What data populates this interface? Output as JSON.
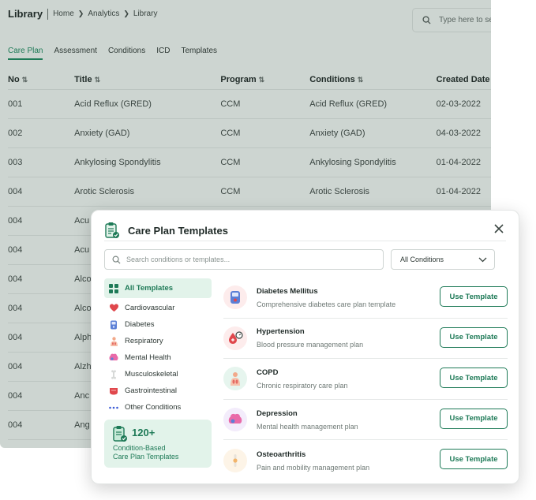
{
  "background": {
    "title": "Library",
    "breadcrumb": [
      "Home",
      "Analytics",
      "Library"
    ],
    "search_placeholder": "Type here to se",
    "tabs": [
      "Care Plan",
      "Assessment",
      "Conditions",
      "ICD",
      "Templates"
    ],
    "active_tab": "Care Plan",
    "columns": [
      "No",
      "Title",
      "Program",
      "Conditions",
      "Created Date"
    ],
    "rows": [
      {
        "no": "001",
        "title": "Acid Reflux (GRED)",
        "program": "CCM",
        "conditions": "Acid Reflux (GRED)",
        "date": "02-03-2022"
      },
      {
        "no": "002",
        "title": "Anxiety (GAD)",
        "program": "CCM",
        "conditions": "Anxiety (GAD)",
        "date": "04-03-2022"
      },
      {
        "no": "003",
        "title": "Ankylosing Spondylitis",
        "program": "CCM",
        "conditions": "Ankylosing Spondylitis",
        "date": "01-04-2022"
      },
      {
        "no": "004",
        "title": "Arotic Sclerosis",
        "program": "CCM",
        "conditions": "Arotic Sclerosis",
        "date": "01-04-2022"
      },
      {
        "no": "004",
        "title": "Acu",
        "program": "",
        "conditions": "",
        "date": ""
      },
      {
        "no": "004",
        "title": "Acu",
        "program": "",
        "conditions": "",
        "date": ""
      },
      {
        "no": "004",
        "title": "Alco",
        "program": "",
        "conditions": "",
        "date": ""
      },
      {
        "no": "004",
        "title": "Alco",
        "program": "",
        "conditions": "",
        "date": ""
      },
      {
        "no": "004",
        "title": "Alph",
        "program": "",
        "conditions": "",
        "date": ""
      },
      {
        "no": "004",
        "title": "Alzh",
        "program": "",
        "conditions": "",
        "date": ""
      },
      {
        "no": "004",
        "title": "Anc",
        "program": "",
        "conditions": "",
        "date": ""
      },
      {
        "no": "004",
        "title": "Ang",
        "program": "",
        "conditions": "",
        "date": ""
      }
    ]
  },
  "modal": {
    "title": "Care Plan Templates",
    "search_placeholder": "Search conditions or templates...",
    "filter_value": "All Conditions",
    "categories": [
      {
        "label": "All Templates",
        "icon": "grid-icon",
        "active": true
      },
      {
        "label": "Cardiovascular",
        "icon": "heart-icon",
        "active": false
      },
      {
        "label": "Diabetes",
        "icon": "glucose-meter-icon",
        "active": false
      },
      {
        "label": "Respiratory",
        "icon": "lungs-person-icon",
        "active": false
      },
      {
        "label": "Mental Health",
        "icon": "brain-icon",
        "active": false
      },
      {
        "label": "Musculoskeletal",
        "icon": "bone-icon",
        "active": false
      },
      {
        "label": "Gastrointestinal",
        "icon": "stomach-icon",
        "active": false
      },
      {
        "label": "Other Conditions",
        "icon": "more-dots-icon",
        "active": false
      }
    ],
    "promo": {
      "count": "120+",
      "line1": "Condition-Based",
      "line2": "Care Plan Templates"
    },
    "templates": [
      {
        "name": "Diabetes Mellitus",
        "desc": "Comprehensive diabetes care plan template",
        "button": "Use Template",
        "icon": "glucose-meter-icon",
        "bg": "#fdecec"
      },
      {
        "name": "Hypertension",
        "desc": "Blood pressure management plan",
        "button": "Use Template",
        "icon": "blood-pressure-icon",
        "bg": "#fdecec"
      },
      {
        "name": "COPD",
        "desc": "Chronic respiratory care plan",
        "button": "Use Template",
        "icon": "lungs-person-icon",
        "bg": "#e6f5ee"
      },
      {
        "name": "Depression",
        "desc": "Mental health management plan",
        "button": "Use Template",
        "icon": "brain-icon",
        "bg": "#f3ecfb"
      },
      {
        "name": "Osteoarthritis",
        "desc": "Pain and mobility management plan",
        "button": "Use Template",
        "icon": "knee-joint-icon",
        "bg": "#fdf4e7"
      }
    ],
    "accent": "#1e7a57"
  }
}
